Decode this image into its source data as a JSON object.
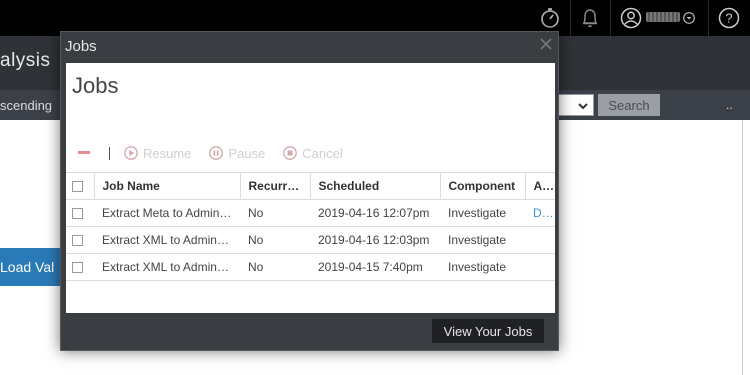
{
  "colors": {
    "topbar": "#000000",
    "subbar": "#2f3237",
    "toolbar": "#3b4049",
    "dialog_frame": "#3a3d42",
    "link": "#3b8fd0",
    "load_button": "#2a7ab8"
  },
  "topbar": {
    "icons": [
      "stopwatch-icon",
      "bell-icon",
      "user-avatar-icon",
      "chevron-down-icon",
      "help-icon"
    ],
    "help_label": "?"
  },
  "background": {
    "page_title": "alysis",
    "sort_label": "scending",
    "search_button": "Search",
    "more_label": "..",
    "load_button": "Load Val"
  },
  "dialog": {
    "window_title": "Jobs",
    "heading": "Jobs",
    "actions": {
      "resume": "Resume",
      "pause": "Pause",
      "cancel": "Cancel"
    },
    "columns": [
      "Job Name",
      "Recurring",
      "Scheduled",
      "Component",
      "Actions"
    ],
    "rows": [
      {
        "name": "Extract Meta to Admin Server",
        "recurring": "No",
        "scheduled": "2019-04-16 12:07pm",
        "component": "Investigate",
        "action": "Download"
      },
      {
        "name": "Extract XML to Admin Server",
        "recurring": "No",
        "scheduled": "2019-04-16 12:03pm",
        "component": "Investigate",
        "action": ""
      },
      {
        "name": "Extract XML to Admin Server",
        "recurring": "No",
        "scheduled": "2019-04-15 7:40pm",
        "component": "Investigate",
        "action": ""
      }
    ],
    "footer_button": "View Your Jobs"
  }
}
